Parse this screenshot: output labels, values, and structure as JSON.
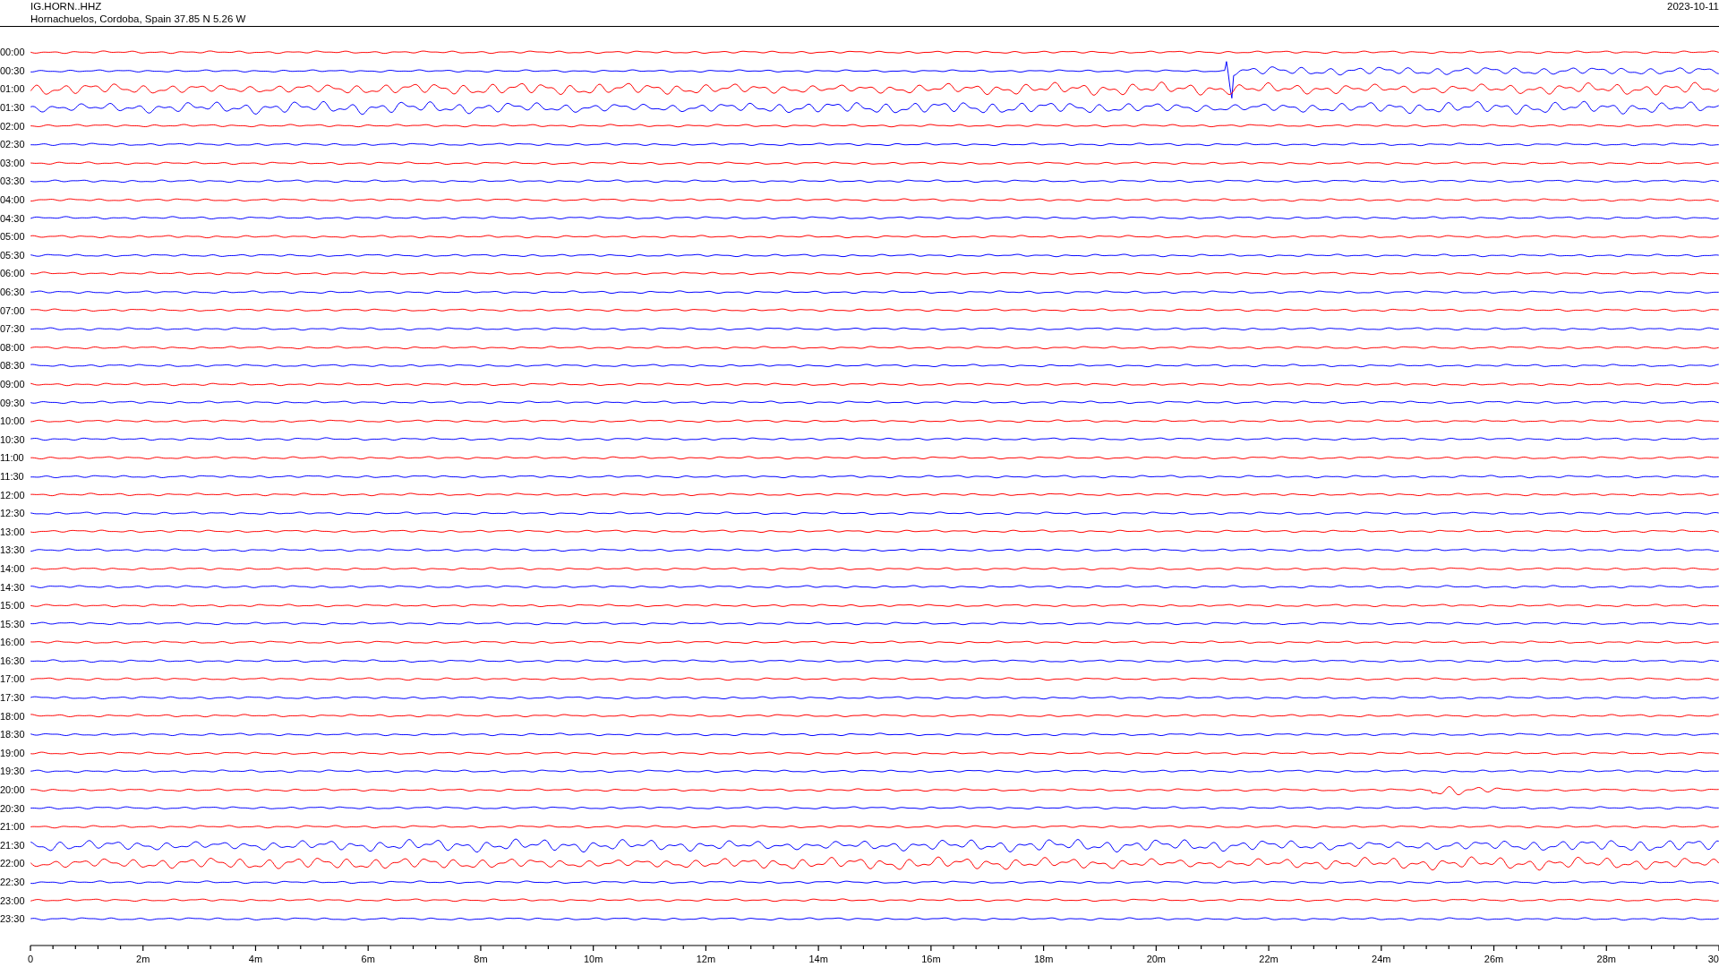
{
  "header": {
    "station": "IG.HORN..HHZ",
    "location": "Hornachuelos, Cordoba, Spain  37.85 N 5.26 W",
    "date": "2023-10-11"
  },
  "helicorder": {
    "rows": [
      {
        "time": "00:00",
        "color": "#ff0000",
        "kind": "quiet"
      },
      {
        "time": "00:30",
        "color": "#0000ff",
        "kind": "quake"
      },
      {
        "time": "01:00",
        "color": "#ff0000",
        "kind": "swell"
      },
      {
        "time": "01:30",
        "color": "#0000ff",
        "kind": "swell"
      },
      {
        "time": "02:00",
        "color": "#ff0000",
        "kind": "quiet"
      },
      {
        "time": "02:30",
        "color": "#0000ff",
        "kind": "quiet"
      },
      {
        "time": "03:00",
        "color": "#ff0000",
        "kind": "quiet"
      },
      {
        "time": "03:30",
        "color": "#0000ff",
        "kind": "quiet"
      },
      {
        "time": "04:00",
        "color": "#ff0000",
        "kind": "quiet"
      },
      {
        "time": "04:30",
        "color": "#0000ff",
        "kind": "quiet"
      },
      {
        "time": "05:00",
        "color": "#ff0000",
        "kind": "quiet"
      },
      {
        "time": "05:30",
        "color": "#0000ff",
        "kind": "quiet"
      },
      {
        "time": "06:00",
        "color": "#ff0000",
        "kind": "quiet"
      },
      {
        "time": "06:30",
        "color": "#0000ff",
        "kind": "quiet"
      },
      {
        "time": "07:00",
        "color": "#ff0000",
        "kind": "quiet"
      },
      {
        "time": "07:30",
        "color": "#0000ff",
        "kind": "quiet"
      },
      {
        "time": "08:00",
        "color": "#ff0000",
        "kind": "quiet"
      },
      {
        "time": "08:30",
        "color": "#0000ff",
        "kind": "quiet"
      },
      {
        "time": "09:00",
        "color": "#ff0000",
        "kind": "quiet"
      },
      {
        "time": "09:30",
        "color": "#0000ff",
        "kind": "quiet"
      },
      {
        "time": "10:00",
        "color": "#ff0000",
        "kind": "quiet"
      },
      {
        "time": "10:30",
        "color": "#0000ff",
        "kind": "quiet"
      },
      {
        "time": "11:00",
        "color": "#ff0000",
        "kind": "quiet"
      },
      {
        "time": "11:30",
        "color": "#0000ff",
        "kind": "quiet"
      },
      {
        "time": "12:00",
        "color": "#ff0000",
        "kind": "quiet"
      },
      {
        "time": "12:30",
        "color": "#0000ff",
        "kind": "quiet"
      },
      {
        "time": "13:00",
        "color": "#ff0000",
        "kind": "quiet"
      },
      {
        "time": "13:30",
        "color": "#0000ff",
        "kind": "quiet"
      },
      {
        "time": "14:00",
        "color": "#ff0000",
        "kind": "quiet"
      },
      {
        "time": "14:30",
        "color": "#0000ff",
        "kind": "quiet"
      },
      {
        "time": "15:00",
        "color": "#ff0000",
        "kind": "quiet"
      },
      {
        "time": "15:30",
        "color": "#0000ff",
        "kind": "quiet"
      },
      {
        "time": "16:00",
        "color": "#ff0000",
        "kind": "quiet"
      },
      {
        "time": "16:30",
        "color": "#0000ff",
        "kind": "quiet"
      },
      {
        "time": "17:00",
        "color": "#ff0000",
        "kind": "quiet"
      },
      {
        "time": "17:30",
        "color": "#0000ff",
        "kind": "quiet"
      },
      {
        "time": "18:00",
        "color": "#ff0000",
        "kind": "quiet"
      },
      {
        "time": "18:30",
        "color": "#0000ff",
        "kind": "quiet"
      },
      {
        "time": "19:00",
        "color": "#ff0000",
        "kind": "quiet"
      },
      {
        "time": "19:30",
        "color": "#0000ff",
        "kind": "quiet"
      },
      {
        "time": "20:00",
        "color": "#ff0000",
        "kind": "burst"
      },
      {
        "time": "20:30",
        "color": "#0000ff",
        "kind": "quiet"
      },
      {
        "time": "21:00",
        "color": "#ff0000",
        "kind": "quiet"
      },
      {
        "time": "21:30",
        "color": "#0000ff",
        "kind": "swell"
      },
      {
        "time": "22:00",
        "color": "#ff0000",
        "kind": "swell"
      },
      {
        "time": "22:30",
        "color": "#0000ff",
        "kind": "quiet"
      },
      {
        "time": "23:00",
        "color": "#ff0000",
        "kind": "quiet"
      },
      {
        "time": "23:30",
        "color": "#0000ff",
        "kind": "quiet"
      }
    ],
    "axis_labels": [
      "0",
      "2m",
      "4m",
      "6m",
      "8m",
      "10m",
      "12m",
      "14m",
      "16m",
      "18m",
      "20m",
      "22m",
      "24m",
      "26m",
      "28m",
      "30"
    ]
  }
}
